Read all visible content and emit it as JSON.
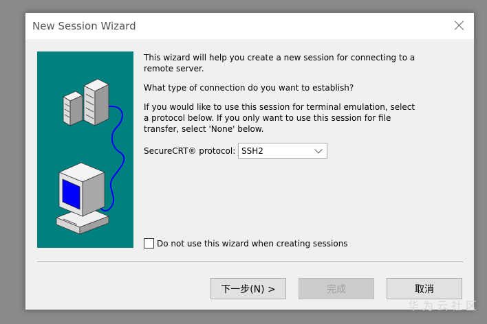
{
  "dialog": {
    "title": "New Session Wizard",
    "intro": "This wizard will help you create a new session for connecting to a remote server.",
    "question": "What type of connection do you want to establish?",
    "instructions": "If you would like to use this session for terminal emulation, select a protocol below.  If you only want to use this session for file transfer, select 'None' below.",
    "protocol_label": "SecureCRT® protocol:",
    "protocol_value": "SSH2",
    "checkbox_label": "Do not use this wizard when creating sessions",
    "checkbox_checked": false,
    "buttons": {
      "next": "下一步(N) >",
      "finish": "完成",
      "cancel": "取消"
    }
  },
  "watermark": "华为云社区",
  "colors": {
    "art_background": "#00807f",
    "cable": "#0000ff",
    "monitor_screen": "#0000ff"
  },
  "icons": {
    "close": "close-icon",
    "dropdown": "chevron-down-icon",
    "server": "server-icon",
    "computer": "computer-icon"
  }
}
